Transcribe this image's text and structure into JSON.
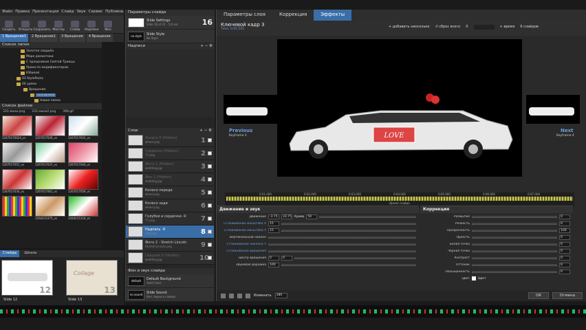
{
  "menu": [
    "Файл",
    "Правка",
    "Презентация",
    "Слайд",
    "Звук",
    "Сервис",
    "Публикация"
  ],
  "toolbar": [
    "Создать",
    "Открыть",
    "Сохранить",
    "Мастер",
    "Слайд",
    "Надписи",
    "Фон"
  ],
  "project_tabs": [
    "1 Вращение1",
    "2 Вращение1",
    "3 Вращение",
    "4 Вращение"
  ],
  "folders_title": "Список папок",
  "folders": [
    "Золотая свадьба",
    "Море романтики",
    "С праздником Святой Троицы",
    "Уроки по модификаторам",
    "Юбилей",
    "03 StylePacks",
    "04 уроки",
    "Вращение",
    "асондниов",
    "Новая папка"
  ],
  "files_title": "Список файлов",
  "files_header": [
    "333 мини.png",
    "333 мини2.png",
    "398.gif"
  ],
  "file_labels": [
    "12670170024_vs",
    "1267017026_vs",
    "1267017031_vs",
    "1267017051_vs",
    "1267017037_vs",
    "1267017044_vs",
    "1267017034_vs",
    "1267017061_vs",
    "1267017059_vs",
    "",
    "1264215375_vs",
    "1264215110_vs"
  ],
  "slides_tabs": {
    "slides": "Слайды",
    "timeline": "Шкала"
  },
  "slides": [
    {
      "label": "Slide 12",
      "num": "12"
    },
    {
      "label": "Slide 13",
      "num": "13"
    }
  ],
  "slide_params": {
    "title": "Параметры слайда",
    "row1": "Slide Settings",
    "row1_sub": "Slide 16 of 21 - 5.0 sec",
    "row1_num": "16",
    "row2": "Slide Style",
    "row2_sub": "No Style",
    "row2_thumb": "no style"
  },
  "captions": {
    "title": "Надписи"
  },
  "layers": {
    "title": "Слои",
    "items": [
      {
        "name": "Колесо 0 (Hidden)",
        "sub": "wheel.png",
        "num": "1",
        "dim": true
      },
      {
        "name": "Сердечко (Hidden)",
        "sub": "77.png",
        "num": "2",
        "dim": true
      },
      {
        "name": "Фото 1 (Hidden)",
        "sub": "wedding.jpg",
        "num": "3",
        "dim": true
      },
      {
        "name": "Фон 1 (Hidden)",
        "sub": "wedding.jpg",
        "num": "4",
        "dim": true
      },
      {
        "name": "Колесо переди",
        "sub": "wheel.png",
        "num": "5",
        "dim": false
      },
      {
        "name": "Колесо зади",
        "sub": "wheel.png",
        "num": "6",
        "dim": false
      },
      {
        "name": "Голубки и сердечки -9",
        "sub": "77.png",
        "num": "7",
        "dim": false
      },
      {
        "name": "Надпись -9",
        "sub": "149.png",
        "num": "8",
        "dim": false,
        "sel": true
      },
      {
        "name": "Фото 2 - Stretch Lincoln",
        "sub": "Stretch-Lincoln.png",
        "num": "9",
        "dim": false
      },
      {
        "name": "Свадьба 8 (Hidden)",
        "sub": "wedding.jpg",
        "num": "10",
        "dim": true
      }
    ]
  },
  "bg_sound": {
    "title": "Фон и звук слайда",
    "bg": "Default Background",
    "bg_sub": "Solid Color",
    "bg_thumb": "default",
    "snd": "Slide Sound",
    "snd_sub": "Вкл. звуки в слайде",
    "snd_thumb": "no sound"
  },
  "right_tabs": [
    "Параметры слоя",
    "Коррекция",
    "Эффекты"
  ],
  "keyframe": {
    "title": "Ключевой кадр 3",
    "time": "Time: 0:05.555",
    "add": "добавить несколько",
    "reset": "сброс всего",
    "x_label": "X",
    "time_label": "время",
    "time_val": "6 слайдов"
  },
  "prev": {
    "label": "Previous",
    "sub": "Keyframe 2"
  },
  "next": {
    "label": "Next",
    "sub": "Keyframe 4"
  },
  "love_text": "LOVE",
  "scrub": {
    "t1": "0:01.000",
    "t2": "0:02.000",
    "t3": "0:03.000",
    "t4": "0:04.000",
    "t5": "0:05.000",
    "t6": "0:06.000",
    "t7": "0:07.000",
    "mid": "Время слайда"
  },
  "motion": {
    "title": "Движение и звук",
    "rows": [
      {
        "label": "Движение",
        "v1": "-3.75",
        "v2": "33.75",
        "extra": "Крива",
        "v3": "50"
      },
      {
        "label": "Сглаживание масштаба Х",
        "v1": "15",
        "blue": true
      },
      {
        "label": "Сглаживание масштаба Y",
        "v1": "15",
        "blue": true
      },
      {
        "label": "Вертикальный наклон",
        "v1": ""
      },
      {
        "label": "Сглаживание наклона Y",
        "v1": "",
        "blue": true
      },
      {
        "label": "Сглаживание вращения",
        "v1": "",
        "blue": true
      },
      {
        "label": "Центр вращения",
        "v1": "0",
        "v2": "0"
      },
      {
        "label": "Звуковая дорожка",
        "v1": "100"
      }
    ]
  },
  "correction": {
    "title": "Коррекция",
    "rows": [
      {
        "label": "Размытие",
        "v": "0"
      },
      {
        "label": "Резкость",
        "v": "0"
      },
      {
        "label": "Прозрачность",
        "v": "100"
      },
      {
        "label": "Яркость",
        "v": "0"
      },
      {
        "label": "Белая точка",
        "v": "0"
      },
      {
        "label": "Черная точка",
        "v": "0"
      },
      {
        "label": "Контраст",
        "v": "0"
      },
      {
        "label": "Оттенок",
        "v": "0"
      },
      {
        "label": "Насыщенность",
        "v": "0"
      }
    ],
    "color_label": "Цвет",
    "color_sub": "Цвет"
  },
  "bottom": {
    "preview": "Изменить",
    "zoom": "180",
    "ok": "OK",
    "cancel": "Отмена"
  },
  "colors": {
    "accent": "#3a6ea8"
  }
}
